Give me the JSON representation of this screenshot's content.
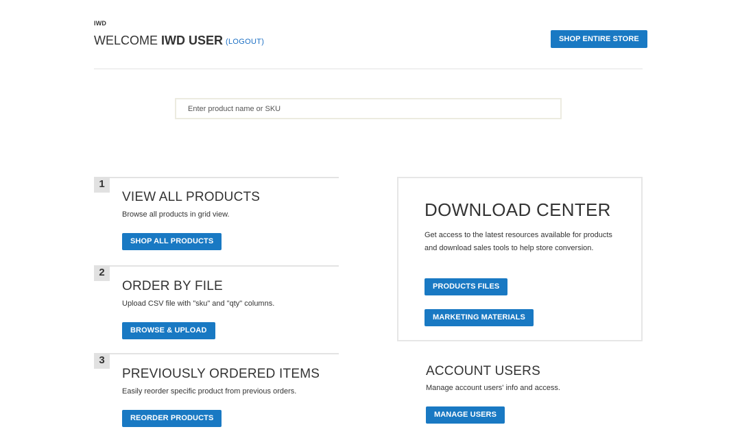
{
  "header": {
    "brand": "IWD",
    "welcome_prefix": "WELCOME ",
    "username": "IWD USER",
    "logout_label": "(LOGOUT)",
    "shop_store_label": "SHOP ENTIRE STORE"
  },
  "search": {
    "placeholder": "Enter product name or SKU"
  },
  "steps": [
    {
      "number": "1",
      "title": "VIEW ALL PRODUCTS",
      "description": "Browse all products in grid view.",
      "button_label": "SHOP ALL PRODUCTS"
    },
    {
      "number": "2",
      "title": "ORDER BY FILE",
      "description": "Upload CSV file with \"sku\" and \"qty\" columns.",
      "button_label": "BROWSE & UPLOAD"
    },
    {
      "number": "3",
      "title": "PREVIOUSLY ORDERED ITEMS",
      "description": "Easily reorder specific product from previous orders.",
      "button_label": "REORDER PRODUCTS"
    }
  ],
  "download_center": {
    "title": "DOWNLOAD CENTER",
    "description": "Get access to the latest resources available for products and download sales tools to help store conversion.",
    "product_files_label": "PRODUCTS FILES",
    "marketing_label": "MARKETING MATERIALS"
  },
  "account_users": {
    "title": "ACCOUNT USERS",
    "description": "Manage account users' info and access.",
    "button_label": "MANAGE USERS"
  },
  "colors": {
    "accent": "#1979c3",
    "link": "#1b6fc4",
    "step_badge": "#e1e1e1",
    "divider": "#e3e3e3"
  }
}
